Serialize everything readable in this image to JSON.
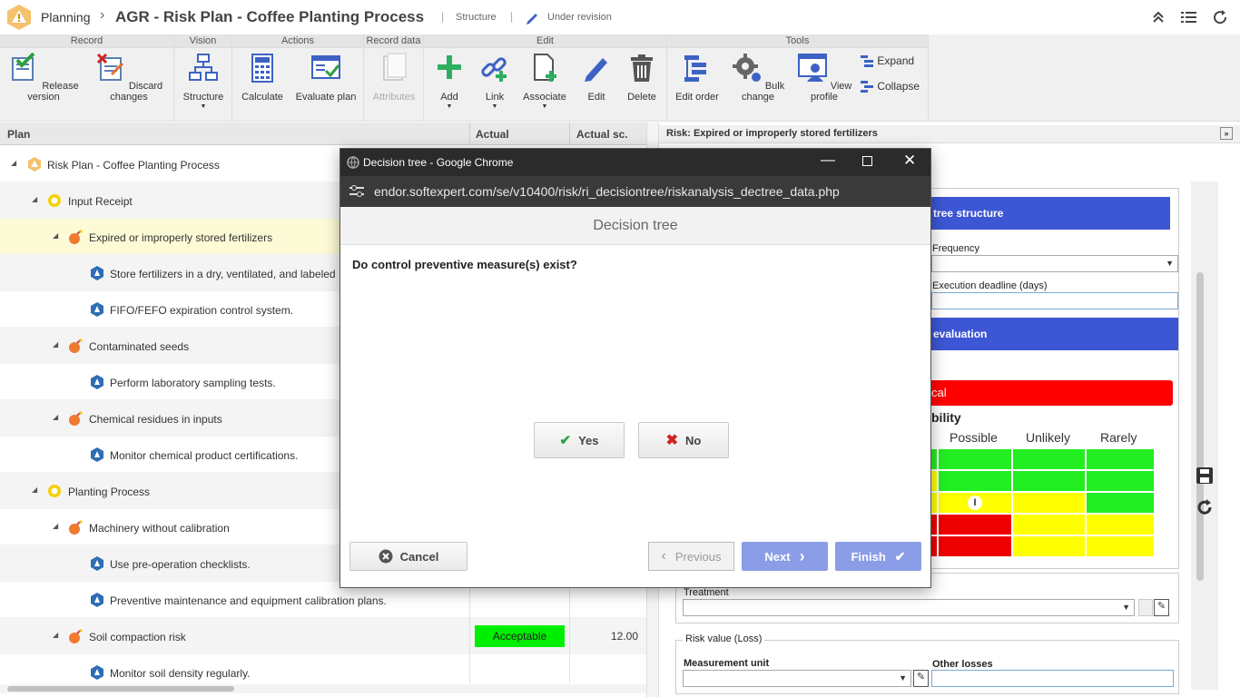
{
  "header": {
    "module": "Planning",
    "separator": "›",
    "title": "AGR - Risk Plan - Coffee Planting Process",
    "structure": "Structure",
    "status": "Under revision"
  },
  "ribbon": {
    "groups": {
      "record": "Record",
      "vision": "Vision",
      "actions": "Actions",
      "record_data": "Record data",
      "edit": "Edit",
      "tools": "Tools"
    },
    "buttons": {
      "release_version": "Release version",
      "discard_changes": "Discard changes",
      "structure": "Structure",
      "calculate": "Calculate",
      "evaluate_plan": "Evaluate plan",
      "attributes": "Attributes",
      "add": "Add",
      "link": "Link",
      "associate": "Associate",
      "edit": "Edit",
      "delete": "Delete",
      "edit_order": "Edit order",
      "bulk_change": "Bulk change",
      "view_profile": "View profile",
      "expand": "Expand",
      "collapse": "Collapse"
    }
  },
  "grid": {
    "columns": [
      "Plan",
      "Actual",
      "Actual sc."
    ],
    "rows": [
      {
        "label": "Risk Plan - Coffee Planting Process",
        "type": "plan"
      },
      {
        "label": "Input Receipt",
        "type": "process"
      },
      {
        "label": "Expired or improperly stored fertilizers",
        "type": "risk"
      },
      {
        "label": "Store fertilizers in a dry, ventilated, and labeled",
        "type": "control"
      },
      {
        "label": "FIFO/FEFO expiration control system.",
        "type": "control"
      },
      {
        "label": "Contaminated seeds",
        "type": "risk"
      },
      {
        "label": "Perform laboratory sampling tests.",
        "type": "control"
      },
      {
        "label": "Chemical residues in inputs",
        "type": "risk"
      },
      {
        "label": "Monitor chemical product certifications.",
        "type": "control"
      },
      {
        "label": "Planting Process",
        "type": "process"
      },
      {
        "label": "Machinery without calibration",
        "type": "risk"
      },
      {
        "label": "Use pre-operation checklists.",
        "type": "control"
      },
      {
        "label": "Preventive maintenance and equipment calibration plans.",
        "type": "control"
      },
      {
        "label": "Soil compaction risk",
        "type": "risk",
        "actual": "Acceptable",
        "score": "12.00"
      },
      {
        "label": "Monitor soil density regularly.",
        "type": "control"
      }
    ]
  },
  "right_panel": {
    "title": "Risk: Expired or improperly stored fertilizers",
    "tree_structure": "tree structure",
    "frequency_label": "Frequency",
    "deadline_label": "Execution deadline (days)",
    "evaluation": "evaluation",
    "critical": "cal",
    "probability": "bility",
    "matrix_headers": [
      "Possible",
      "Unlikely",
      "Rarely"
    ],
    "marker": "I",
    "treatment_label": "Treatment",
    "risk_value_legend": "Risk value (Loss)",
    "measurement_unit_label": "Measurement unit",
    "other_losses_label": "Other losses"
  },
  "dialog": {
    "window_title": "Decision tree - Google Chrome",
    "url": "endor.softexpert.com/se/v10400/risk/ri_decisiontree/riskanalysis_dectree_data.php",
    "heading": "Decision tree",
    "question": "Do control preventive measure(s) exist?",
    "yes": "Yes",
    "no": "No",
    "cancel": "Cancel",
    "previous": "Previous",
    "next": "Next",
    "finish": "Finish"
  },
  "colors": {
    "accent_blue": "#3d56d4",
    "acceptable_green": "#00ee00",
    "critical_red": "#ff0000",
    "selected_row": "#fdfbd6"
  }
}
